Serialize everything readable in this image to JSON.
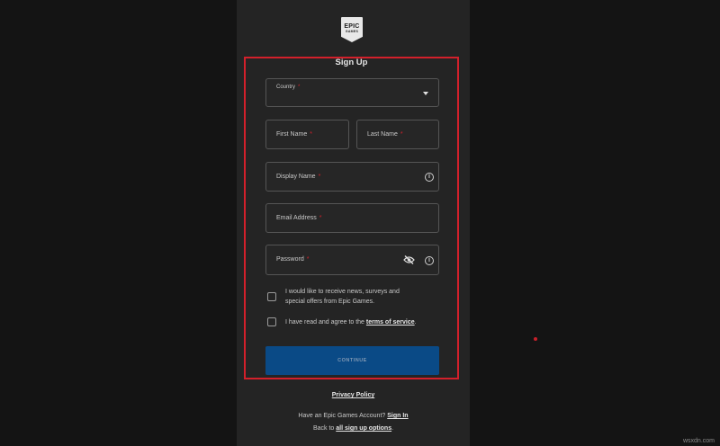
{
  "logo": {
    "line1": "EPIC",
    "line2": "GAMES"
  },
  "form": {
    "title": "Sign Up",
    "country": {
      "label": "Country",
      "required": "*"
    },
    "first_name": {
      "label": "First Name",
      "required": "*"
    },
    "last_name": {
      "label": "Last Name",
      "required": "*"
    },
    "display_name": {
      "label": "Display Name",
      "required": "*"
    },
    "email": {
      "label": "Email Address",
      "required": "*"
    },
    "password": {
      "label": "Password",
      "required": "*"
    },
    "news_checkbox": {
      "line1": "I would like to receive news, surveys and",
      "line2": "special offers from Epic Games."
    },
    "terms_checkbox": {
      "text": "I have read and agree to the",
      "link": "terms of service",
      "end": "."
    },
    "continue_label": "CONTINUE"
  },
  "footer": {
    "privacy": "Privacy Policy",
    "have_account": "Have an Epic Games Account?",
    "sign_in": "Sign In",
    "back_to": "Back to",
    "all_options": "all sign up options",
    "end": "."
  },
  "colors": {
    "accent_red": "#d3202b",
    "button_blue": "#0a4a86"
  },
  "watermark": "wsxdn.com"
}
